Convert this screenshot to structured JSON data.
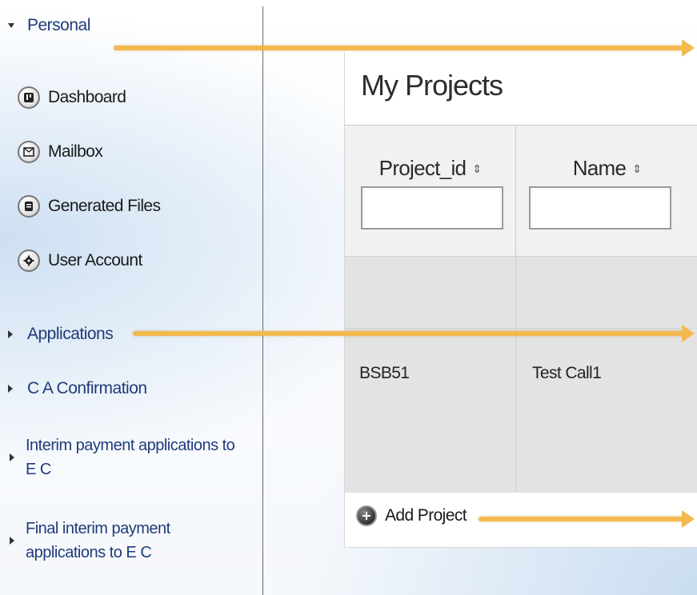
{
  "sidebar": {
    "personal": {
      "label": "Personal",
      "items": [
        {
          "label": "Dashboard",
          "icon": "dashboard-icon"
        },
        {
          "label": "Mailbox",
          "icon": "mail-icon"
        },
        {
          "label": "Generated Files",
          "icon": "files-icon"
        },
        {
          "label": "User Account",
          "icon": "gear-icon"
        }
      ]
    },
    "applications": {
      "label": "Applications"
    },
    "ca_confirmation": {
      "label": "C A Confirmation"
    },
    "interim": {
      "label_line1": "Interim payment applications to",
      "label_line2": "E C"
    },
    "final_interim": {
      "label_line1": "Final interim payment",
      "label_line2": "applications to E C"
    }
  },
  "main": {
    "title": "My Projects",
    "columns": [
      {
        "label": "Project_id",
        "sort_icon": "sort-icon",
        "filter_value": ""
      },
      {
        "label": "Name",
        "sort_icon": "sort-icon",
        "filter_value": ""
      }
    ],
    "rows": [
      {
        "project_id": "BSB51",
        "name": "Test Call1"
      }
    ],
    "add_label": "Add Project"
  },
  "colors": {
    "arrow": "#f3b94f",
    "link": "#1f3b7a"
  }
}
